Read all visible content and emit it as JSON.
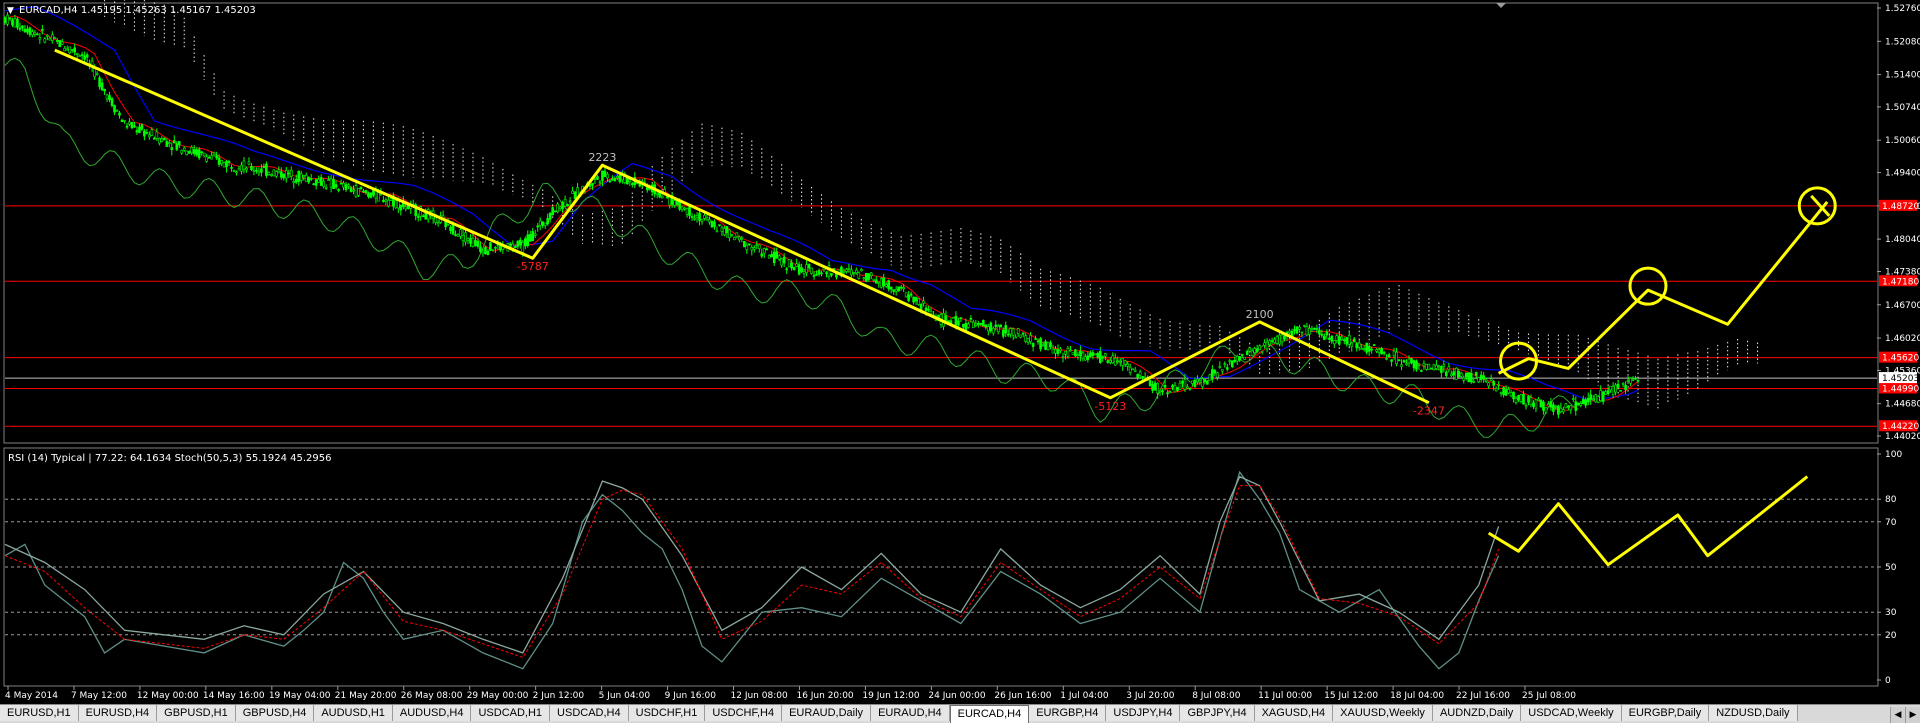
{
  "window": {
    "main_header": "EURCAD,H4  1.45195 1.45263 1.45167 1.45203",
    "sub_header": "RSI (14) Typical | 77.22: 64.1634  Stoch(50,5,3) 55.1924 45.2956"
  },
  "colors": {
    "background": "#000000",
    "bull": "#00ff00",
    "bear": "#00ff00",
    "kijun": "#0000ff",
    "tenkan": "#ff0000",
    "chikou": "#2fa82f",
    "cloud_dots": "#ffffff",
    "level_lines": "#ff0000",
    "current_price": "#c0c0c0",
    "zigzag": "#ffff00",
    "rsi": "#5f8f88",
    "stoch_main": "#8aa8a0",
    "stoch_signal": "#ff0000"
  },
  "chart_data": [
    {
      "type": "candlestick",
      "symbol": "EURCAD",
      "timeframe": "H4",
      "ylim": [
        1.4402,
        1.5276
      ],
      "y_ticks": [
        "1.52760",
        "1.52080",
        "1.51400",
        "1.50740",
        "1.50060",
        "1.49400",
        "1.48720",
        "1.48040",
        "1.47380",
        "1.46700",
        "1.46020",
        "1.45360",
        "1.44680",
        "1.44020"
      ],
      "x_ticks": [
        "4 May 2014",
        "7 May 12:00",
        "12 May 00:00",
        "14 May 16:00",
        "19 May 04:00",
        "21 May 20:00",
        "26 May 08:00",
        "29 May 00:00",
        "2 Jun 12:00",
        "5 Jun 04:00",
        "9 Jun 16:00",
        "12 Jun 08:00",
        "16 Jun 20:00",
        "19 Jun 12:00",
        "24 Jun 00:00",
        "26 Jun 16:00",
        "1 Jul 04:00",
        "3 Jul 20:00",
        "8 Jul 08:00",
        "11 Jul 00:00",
        "15 Jul 12:00",
        "18 Jul 04:00",
        "22 Jul 16:00",
        "25 Jul 08:00"
      ],
      "current_price": "1.45203",
      "price_level_tags": [
        "1.48720",
        "1.47180",
        "1.45620",
        "1.44990",
        "1.44220"
      ],
      "horizontal_levels": [
        1.4872,
        1.4718,
        1.4562,
        1.4499,
        1.4422
      ],
      "price_path": [
        [
          0,
          1.5255
        ],
        [
          8,
          1.518
        ],
        [
          12,
          1.504
        ],
        [
          18,
          1.499
        ],
        [
          22,
          1.496
        ],
        [
          30,
          1.493
        ],
        [
          38,
          1.489
        ],
        [
          44,
          1.484
        ],
        [
          48,
          1.4785
        ],
        [
          52,
          1.479
        ],
        [
          55,
          1.486
        ],
        [
          60,
          1.4935
        ],
        [
          64,
          1.492
        ],
        [
          68,
          1.487
        ],
        [
          74,
          1.48
        ],
        [
          80,
          1.474
        ],
        [
          86,
          1.4735
        ],
        [
          90,
          1.47
        ],
        [
          94,
          1.464
        ],
        [
          100,
          1.462
        ],
        [
          106,
          1.4575
        ],
        [
          112,
          1.4555
        ],
        [
          116,
          1.4495
        ],
        [
          120,
          1.451
        ],
        [
          124,
          1.456
        ],
        [
          130,
          1.462
        ],
        [
          136,
          1.459
        ],
        [
          142,
          1.4545
        ],
        [
          148,
          1.452
        ],
        [
          152,
          1.448
        ],
        [
          156,
          1.4455
        ],
        [
          160,
          1.448
        ],
        [
          164,
          1.452
        ]
      ],
      "zigzag": {
        "points": [
          [
            5,
            1.519
          ],
          [
            53,
            1.4765
          ],
          [
            60,
            1.4955
          ],
          [
            111,
            1.448
          ],
          [
            126,
            1.4635
          ],
          [
            143,
            1.447
          ]
        ],
        "labels": [
          "",
          "-5787",
          "2223",
          "-5123",
          "2100",
          "-2347"
        ],
        "projection": [
          [
            150,
            1.453
          ],
          [
            153,
            1.456
          ],
          [
            157,
            1.454
          ],
          [
            165,
            1.47
          ],
          [
            173,
            1.463
          ],
          [
            183,
            1.488
          ]
        ],
        "circles": [
          [
            152,
            1.4555
          ],
          [
            165,
            1.4708
          ],
          [
            182,
            1.4872
          ]
        ]
      },
      "x_range": [
        0,
        188
      ]
    },
    {
      "type": "line",
      "indicator": "RSI (14) + Stochastic(50,5,3)",
      "ylim": [
        0,
        100
      ],
      "y_ticks": [
        "100",
        "80",
        "70",
        "50",
        "30",
        "20",
        "0"
      ],
      "dashed_levels": [
        80,
        70,
        50,
        30,
        20
      ],
      "series": [
        {
          "values": [
            [
              0,
              55
            ],
            [
              2,
              60
            ],
            [
              4,
              42
            ],
            [
              8,
              28
            ],
            [
              10,
              12
            ],
            [
              12,
              18
            ],
            [
              16,
              15
            ],
            [
              20,
              12
            ],
            [
              24,
              20
            ],
            [
              28,
              15
            ],
            [
              30,
              22
            ],
            [
              32,
              30
            ],
            [
              34,
              52
            ],
            [
              36,
              45
            ],
            [
              38,
              30
            ],
            [
              40,
              18
            ],
            [
              44,
              22
            ],
            [
              48,
              12
            ],
            [
              52,
              5
            ],
            [
              55,
              25
            ],
            [
              58,
              70
            ],
            [
              60,
              82
            ],
            [
              62,
              75
            ],
            [
              64,
              65
            ],
            [
              66,
              58
            ],
            [
              68,
              40
            ],
            [
              70,
              15
            ],
            [
              72,
              8
            ],
            [
              76,
              30
            ],
            [
              80,
              32
            ],
            [
              84,
              28
            ],
            [
              88,
              45
            ],
            [
              92,
              35
            ],
            [
              96,
              25
            ],
            [
              100,
              48
            ],
            [
              104,
              38
            ],
            [
              108,
              25
            ],
            [
              112,
              30
            ],
            [
              116,
              45
            ],
            [
              120,
              30
            ],
            [
              122,
              62
            ],
            [
              124,
              92
            ],
            [
              126,
              80
            ],
            [
              128,
              65
            ],
            [
              130,
              40
            ],
            [
              134,
              30
            ],
            [
              138,
              40
            ],
            [
              142,
              15
            ],
            [
              144,
              5
            ],
            [
              146,
              12
            ],
            [
              148,
              35
            ],
            [
              150,
              55
            ]
          ]
        },
        {
          "values": [
            [
              0,
              60
            ],
            [
              4,
              52
            ],
            [
              8,
              40
            ],
            [
              12,
              22
            ],
            [
              16,
              20
            ],
            [
              20,
              18
            ],
            [
              24,
              24
            ],
            [
              28,
              20
            ],
            [
              32,
              38
            ],
            [
              36,
              48
            ],
            [
              40,
              30
            ],
            [
              44,
              25
            ],
            [
              48,
              18
            ],
            [
              52,
              12
            ],
            [
              56,
              45
            ],
            [
              60,
              88
            ],
            [
              62,
              85
            ],
            [
              64,
              80
            ],
            [
              68,
              55
            ],
            [
              72,
              22
            ],
            [
              76,
              32
            ],
            [
              80,
              50
            ],
            [
              84,
              40
            ],
            [
              88,
              56
            ],
            [
              92,
              38
            ],
            [
              96,
              30
            ],
            [
              100,
              58
            ],
            [
              104,
              42
            ],
            [
              108,
              32
            ],
            [
              112,
              40
            ],
            [
              116,
              55
            ],
            [
              120,
              38
            ],
            [
              122,
              70
            ],
            [
              124,
              90
            ],
            [
              126,
              86
            ],
            [
              128,
              70
            ],
            [
              132,
              35
            ],
            [
              136,
              38
            ],
            [
              140,
              30
            ],
            [
              144,
              18
            ],
            [
              148,
              42
            ],
            [
              150,
              68
            ]
          ]
        },
        {
          "values": [
            [
              0,
              55
            ],
            [
              4,
              48
            ],
            [
              8,
              32
            ],
            [
              12,
              18
            ],
            [
              16,
              16
            ],
            [
              20,
              14
            ],
            [
              24,
              20
            ],
            [
              28,
              18
            ],
            [
              32,
              32
            ],
            [
              36,
              48
            ],
            [
              40,
              26
            ],
            [
              44,
              22
            ],
            [
              48,
              16
            ],
            [
              52,
              10
            ],
            [
              56,
              38
            ],
            [
              60,
              80
            ],
            [
              62,
              84
            ],
            [
              64,
              82
            ],
            [
              68,
              58
            ],
            [
              72,
              18
            ],
            [
              76,
              26
            ],
            [
              80,
              42
            ],
            [
              84,
              38
            ],
            [
              88,
              52
            ],
            [
              92,
              36
            ],
            [
              96,
              28
            ],
            [
              100,
              52
            ],
            [
              104,
              40
            ],
            [
              108,
              28
            ],
            [
              112,
              36
            ],
            [
              116,
              50
            ],
            [
              120,
              36
            ],
            [
              122,
              62
            ],
            [
              124,
              86
            ],
            [
              126,
              86
            ],
            [
              128,
              72
            ],
            [
              132,
              36
            ],
            [
              136,
              34
            ],
            [
              140,
              28
            ],
            [
              144,
              16
            ],
            [
              148,
              34
            ],
            [
              150,
              58
            ]
          ]
        }
      ],
      "projection": [
        [
          149,
          65
        ],
        [
          152,
          57
        ],
        [
          156,
          78
        ],
        [
          161,
          51
        ],
        [
          168,
          73
        ],
        [
          171,
          55
        ],
        [
          181,
          90
        ]
      ],
      "x_range": [
        0,
        188
      ]
    }
  ],
  "tabs": [
    {
      "label": "EURUSD,H1",
      "active": false
    },
    {
      "label": "EURUSD,H4",
      "active": false
    },
    {
      "label": "GBPUSD,H1",
      "active": false
    },
    {
      "label": "GBPUSD,H4",
      "active": false
    },
    {
      "label": "AUDUSD,H1",
      "active": false
    },
    {
      "label": "AUDUSD,H4",
      "active": false
    },
    {
      "label": "USDCAD,H1",
      "active": false
    },
    {
      "label": "USDCAD,H4",
      "active": false
    },
    {
      "label": "USDCHF,H1",
      "active": false
    },
    {
      "label": "USDCHF,H4",
      "active": false
    },
    {
      "label": "EURAUD,Daily",
      "active": false
    },
    {
      "label": "EURAUD,H4",
      "active": false
    },
    {
      "label": "EURCAD,H4",
      "active": true
    },
    {
      "label": "EURGBP,H4",
      "active": false
    },
    {
      "label": "USDJPY,H4",
      "active": false
    },
    {
      "label": "GBPJPY,H4",
      "active": false
    },
    {
      "label": "XAGUSD,H4",
      "active": false
    },
    {
      "label": "XAUUSD,Weekly",
      "active": false
    },
    {
      "label": "AUDNZD,Daily",
      "active": false
    },
    {
      "label": "USDCAD,Weekly",
      "active": false
    },
    {
      "label": "EURGBP,Daily",
      "active": false
    },
    {
      "label": "NZDUSD,Daily",
      "active": false
    }
  ],
  "icons": {
    "tab_left": "triangle-left-icon",
    "tab_right": "triangle-right-icon",
    "menu": "triangle-down-icon"
  }
}
